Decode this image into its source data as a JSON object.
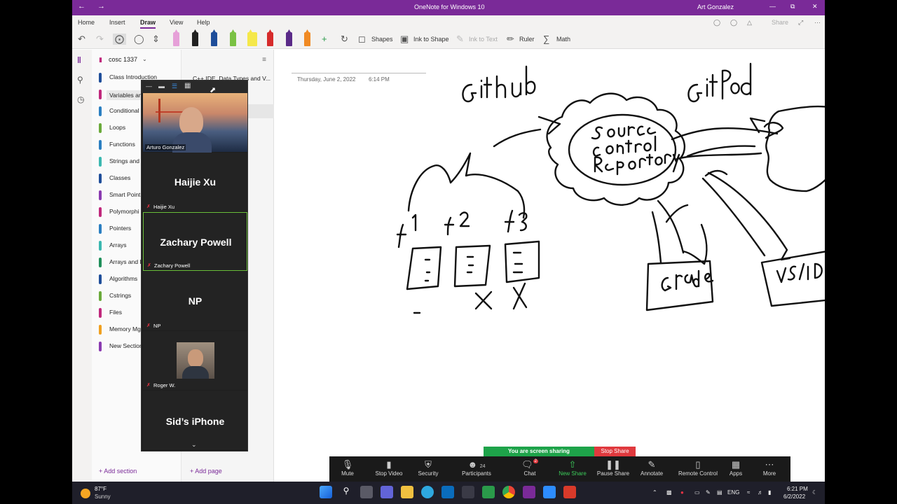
{
  "window": {
    "title": "OneNote for Windows 10",
    "user": "Art Gonzalez",
    "back": "←",
    "forward": "→",
    "minimize": "—",
    "restore": "⧉",
    "close": "✕"
  },
  "ribbon": {
    "tabs": [
      "Home",
      "Insert",
      "Draw",
      "View",
      "Help"
    ],
    "active_tab": "Draw",
    "share_label": "Share",
    "tools": {
      "shapes": "Shapes",
      "ink_to_shape": "Ink to Shape",
      "ink_to_text": "Ink to Text",
      "ruler": "Ruler",
      "math": "Math"
    },
    "pen_colors": [
      "#e6a0d8",
      "#222222",
      "#1f4e9a",
      "#7ac143",
      "#f5e84a",
      "#d62b2b",
      "#5a2a88",
      "#f08a24"
    ]
  },
  "notebook": {
    "name": "cosc 1337",
    "sections": [
      {
        "label": "Class Introduction",
        "color": "#1f4e9a"
      },
      {
        "label": "Variables an",
        "color": "#c0287c"
      },
      {
        "label": "Conditional",
        "color": "#2a7fc1"
      },
      {
        "label": "Loops",
        "color": "#6aaa3a"
      },
      {
        "label": "Functions",
        "color": "#2a7fc1"
      },
      {
        "label": "Strings and",
        "color": "#3bb8b0"
      },
      {
        "label": "Classes",
        "color": "#1f4e9a"
      },
      {
        "label": "Smart Point",
        "color": "#8a3ab0"
      },
      {
        "label": "Polymorphi",
        "color": "#c0287c"
      },
      {
        "label": "Pointers",
        "color": "#2a7fc1"
      },
      {
        "label": "Arrays",
        "color": "#3bb8b0"
      },
      {
        "label": "Arrays and F",
        "color": "#1f8f5a"
      },
      {
        "label": "Algorithms",
        "color": "#1f4e9a"
      },
      {
        "label": "Cstrings",
        "color": "#6aaa3a"
      },
      {
        "label": "Files",
        "color": "#c0287c"
      },
      {
        "label": "Memory Mg",
        "color": "#f0a020"
      },
      {
        "label": "New Section",
        "color": "#8a3ab0"
      }
    ],
    "page_snippet": "C++ IDE, Data Types and V...",
    "add_section": "Add section",
    "add_page": "Add page"
  },
  "page": {
    "date": "Thursday, June 2, 2022",
    "time": "6:14 PM"
  },
  "zoom": {
    "participants_tiles": [
      {
        "label": "Arturo Gonzalez",
        "has_video": true
      },
      {
        "name": "Haijie Xu",
        "label": "Haijie Xu"
      },
      {
        "name": "Zachary Powell",
        "label": "Zachary Powell"
      },
      {
        "name": "NP",
        "label": "NP"
      },
      {
        "label": "Roger W.",
        "has_video": true
      },
      {
        "name": "Sid’s iPhone",
        "label": ""
      }
    ],
    "sharing_text": "You are screen sharing",
    "stop_share": "Stop Share",
    "controls": [
      "Mute",
      "Stop Video",
      "Security",
      "Participants",
      "Chat",
      "New Share",
      "Pause Share",
      "Annotate",
      "Remote Control",
      "Apps",
      "More"
    ],
    "participant_count": "24",
    "chat_badge": "2"
  },
  "taskbar": {
    "weather_temp": "87°F",
    "weather_desc": "Sunny",
    "lang": "ENG",
    "time": "6:21 PM",
    "date": "6/2/2022"
  }
}
